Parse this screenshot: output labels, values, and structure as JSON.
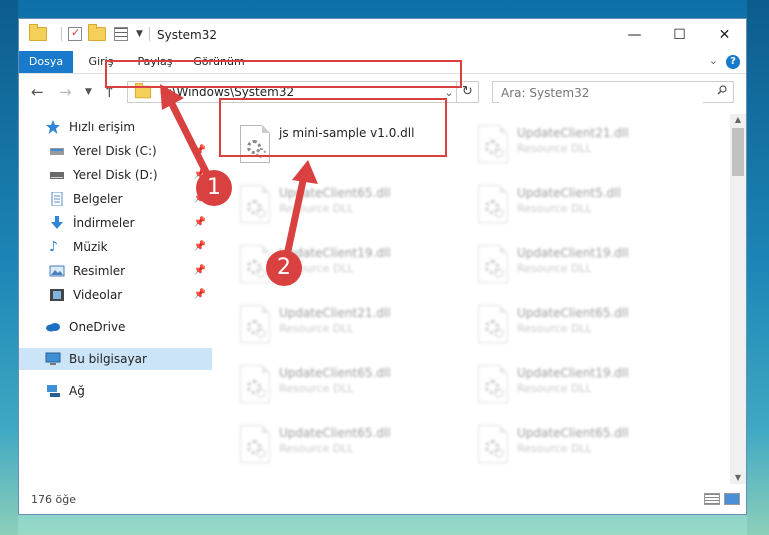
{
  "window": {
    "title": "System32",
    "controls": {
      "minimize": "—",
      "maximize": "☐",
      "close": "✕"
    }
  },
  "ribbon": {
    "tabs": [
      "Dosya",
      "Giriş",
      "Paylaş",
      "Görünüm"
    ],
    "help": "?"
  },
  "address": {
    "path": "C:\\Windows\\System32",
    "search_placeholder": "Ara: System32"
  },
  "sidebar": {
    "items": [
      {
        "label": "Hızlı erişim",
        "icon": "star-icon",
        "pinned": false
      },
      {
        "label": "Yerel Disk (C:)",
        "icon": "drive-icon",
        "pinned": true
      },
      {
        "label": "Yerel Disk (D:)",
        "icon": "drive-icon",
        "pinned": true
      },
      {
        "label": "Belgeler",
        "icon": "document-icon",
        "pinned": true
      },
      {
        "label": "İndirmeler",
        "icon": "download-icon",
        "pinned": true
      },
      {
        "label": "Müzik",
        "icon": "music-icon",
        "pinned": true
      },
      {
        "label": "Resimler",
        "icon": "pictures-icon",
        "pinned": true
      },
      {
        "label": "Videolar",
        "icon": "video-icon",
        "pinned": true
      },
      {
        "label": "OneDrive",
        "icon": "cloud-icon",
        "pinned": false
      },
      {
        "label": "Bu bilgisayar",
        "icon": "computer-icon",
        "pinned": false,
        "selected": true
      },
      {
        "label": "Ağ",
        "icon": "network-icon",
        "pinned": false
      }
    ]
  },
  "files": [
    {
      "name": "js mini-sample v1.0.dll",
      "type": "",
      "highlighted": true
    },
    {
      "name": "UpdateClient21.dll",
      "type": "Resource DLL"
    },
    {
      "name": "UpdateClient65.dll",
      "type": "Resource DLL"
    },
    {
      "name": "UpdateClient5.dll",
      "type": "Resource DLL"
    },
    {
      "name": "UpdateClient19.dll",
      "type": "Resource DLL"
    },
    {
      "name": "UpdateClient19.dll",
      "type": "Resource DLL"
    },
    {
      "name": "UpdateClient21.dll",
      "type": "Resource DLL"
    },
    {
      "name": "UpdateClient65.dll",
      "type": "Resource DLL"
    },
    {
      "name": "UpdateClient65.dll",
      "type": "Resource DLL"
    },
    {
      "name": "UpdateClient19.dll",
      "type": "Resource DLL"
    },
    {
      "name": "UpdateClient65.dll",
      "type": "Resource DLL"
    },
    {
      "name": "UpdateClient65.dll",
      "type": "Resource DLL"
    }
  ],
  "status": {
    "item_count": "176 öğe"
  },
  "steps": {
    "one": "1",
    "two": "2"
  },
  "colors": {
    "accent": "#1979ca",
    "highlight": "#d94040",
    "selected": "#cce4f7"
  }
}
